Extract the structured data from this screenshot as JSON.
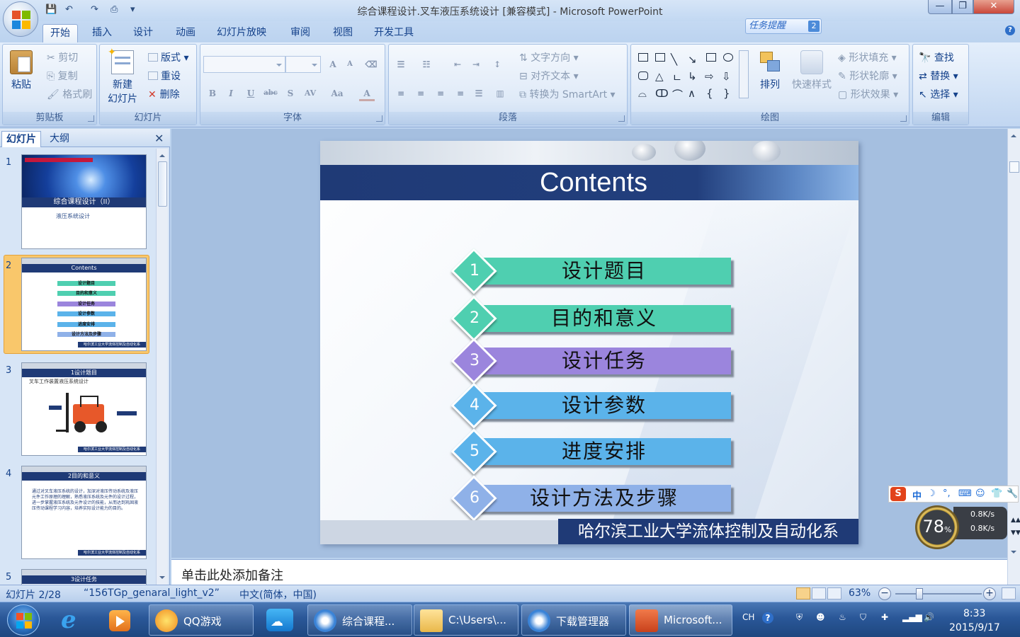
{
  "window": {
    "title": "综合课程设计.叉车液压系统设计 [兼容模式] - Microsoft PowerPoint",
    "minimize_glyph": "—",
    "maximize_glyph": "❐",
    "close_glyph": "✕"
  },
  "ribbon": {
    "tabs": [
      "开始",
      "插入",
      "设计",
      "动画",
      "幻灯片放映",
      "审阅",
      "视图",
      "开发工具"
    ],
    "active_tab": "开始",
    "task_reminder": "任务提醒",
    "task_reminder_count": "2",
    "groups": {
      "clipboard": {
        "label": "剪贴板",
        "paste": "粘贴",
        "cut": "剪切",
        "copy": "复制",
        "format_painter": "格式刷"
      },
      "slides": {
        "label": "幻灯片",
        "new_slide_line1": "新建",
        "new_slide_line2": "幻灯片",
        "layout": "版式",
        "reset": "重设",
        "delete": "删除"
      },
      "font": {
        "label": "字体",
        "bold": "B",
        "italic": "I",
        "underline": "U",
        "strike": "abc",
        "shadow": "S",
        "spacing": "AV",
        "case": "Aa",
        "color": "A",
        "grow": "A",
        "shrink": "A"
      },
      "paragraph": {
        "label": "段落",
        "text_direction": "文字方向",
        "align_text": "对齐文本",
        "smartart": "转换为 SmartArt"
      },
      "drawing": {
        "label": "绘图",
        "arrange": "排列",
        "quick_styles": "快速样式",
        "shape_fill": "形状填充",
        "shape_outline": "形状轮廓",
        "shape_effects": "形状效果"
      },
      "editing": {
        "label": "编辑",
        "find": "查找",
        "replace": "替换",
        "select": "选择"
      }
    }
  },
  "slide_pane": {
    "tabs": [
      "幻灯片",
      "大纲"
    ],
    "thumbnails": [
      {
        "number": "1",
        "title": "综合课程设计（II）",
        "subtitle": "液压系统设计"
      },
      {
        "number": "2",
        "title": "Contents",
        "items": [
          "设计题目",
          "目的和意义",
          "设计任务",
          "设计参数",
          "进度安排",
          "设计方法及步骤"
        ],
        "footer": "哈尔滨工业大学流体控制及自动化系"
      },
      {
        "number": "3",
        "title": "1设计题目",
        "line": "叉车工作装置液压系统设计",
        "footer": "哈尔滨工业大学流体控制及自动化系"
      },
      {
        "number": "4",
        "title": "2目的和意义",
        "body": "通过对叉车液压系统的设计，加深对液压传动系统及液压元件工作原理的理解，熟悉液压系统及元件的设计过程，进一步掌握液压系统及元件设计的技能，从而达到巩固液压传动课程学习内容，培养实际设计能力的目的。",
        "footer": "哈尔滨工业大学流体控制及自动化系"
      },
      {
        "number": "5",
        "title": "3设计任务"
      }
    ],
    "selected_index": 1
  },
  "current_slide": {
    "title": "Contents",
    "items": [
      {
        "num": "1",
        "label": "设计题目",
        "color": "#4fcfb0"
      },
      {
        "num": "2",
        "label": "目的和意义",
        "color": "#4fcfb0"
      },
      {
        "num": "3",
        "label": "设计任务",
        "color": "#9b85dd"
      },
      {
        "num": "4",
        "label": "设计参数",
        "color": "#5bb3ea"
      },
      {
        "num": "5",
        "label": "进度安排",
        "color": "#5bb3ea"
      },
      {
        "num": "6",
        "label": "设计方法及步骤",
        "color": "#8fb1e8"
      }
    ],
    "footer": "哈尔滨工业大学流体控制及自动化系",
    "header_color": "#1f3a76"
  },
  "notes": {
    "placeholder": "单击此处添加备注"
  },
  "status_bar": {
    "slide_index": "幻灯片 2/28",
    "theme": "“156TGp_genaral_light_v2”",
    "language": "中文(简体，中国)",
    "zoom": "63%"
  },
  "ime": {
    "mode": "中",
    "cpu": "78",
    "cpu_unit": "%",
    "up_speed": "0.8K/s",
    "down_speed": "0.8K/s"
  },
  "taskbar": {
    "items": [
      {
        "label": "QQ游戏"
      },
      {
        "label": "综合课程..."
      },
      {
        "label": "C:\\Users\\..."
      },
      {
        "label": "下载管理器"
      },
      {
        "label": "Microsoft..."
      }
    ],
    "tray_lang": "CH",
    "time": "8:33",
    "date": "2015/9/17"
  }
}
